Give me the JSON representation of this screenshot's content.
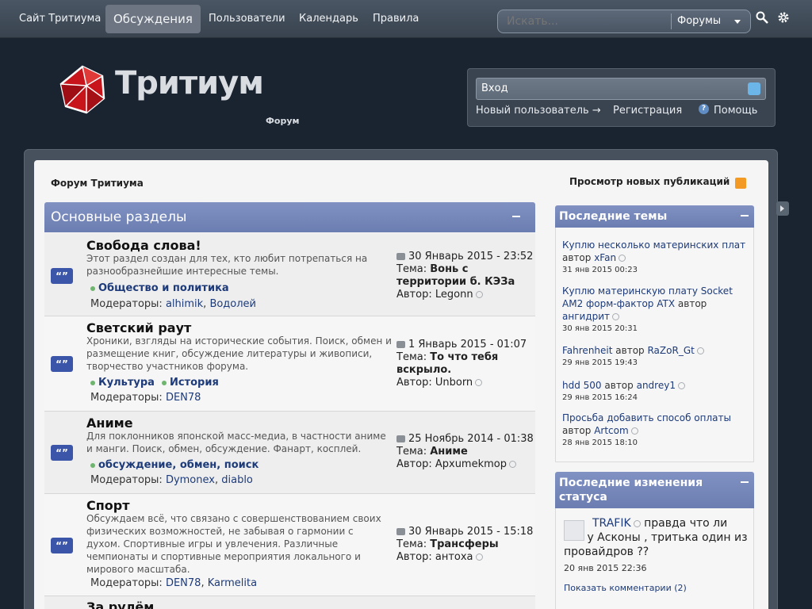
{
  "nav": {
    "items": [
      "Сайт Тритиума",
      "Обсуждения",
      "Пользователи",
      "Календарь",
      "Правила"
    ],
    "active": "Обсуждения",
    "search_placeholder": "Искать...",
    "search_scope": "Форумы"
  },
  "header": {
    "logo_text": "Тритиум",
    "logo_sub": "Форум",
    "login_label": "Вход",
    "new_user": "Новый пользователь →",
    "register": "Регистрация",
    "help": "Помощь"
  },
  "page": {
    "breadcrumb": "Форум Тритиума",
    "new_posts": "Просмотр новых публикаций",
    "category_title": "Основные разделы"
  },
  "forums": [
    {
      "name": "Свобода слова!",
      "desc": "Этот раздел создан для тех, кто любит потрепаться на разнообразнейшие интересные темы.",
      "subforums": [
        "Общество и политика"
      ],
      "moderators_label": "Модераторы:",
      "moderators": [
        "alhimik",
        "Водолей"
      ],
      "last_date": "30 Январь 2015 - 23:52",
      "topic_label": "Тема:",
      "last_topic": "Вонь с территории б. КЭЗа",
      "author_label": "Автор:",
      "last_author": "Legonn"
    },
    {
      "name": "Светский раут",
      "desc": "Хроники, взгляды на исторические события. Поиск, обмен и размещение книг, обсуждение литературы и живописи, творчество участников форума.",
      "subforums": [
        "Культура",
        "История"
      ],
      "moderators_label": "Модераторы:",
      "moderators": [
        "DEN78"
      ],
      "last_date": "1 Январь 2015 - 01:07",
      "topic_label": "Тема:",
      "last_topic": "То что тебя вскрыло.",
      "author_label": "Автор:",
      "last_author": "Unborn"
    },
    {
      "name": "Аниме",
      "desc": "Для поклонников японской масс-медиа, в частности аниме и манги. Поиск, обмен, обсуждение. Фанарт, косплей.",
      "subforums": [
        "обсуждение, обмен, поиск"
      ],
      "moderators_label": "Модераторы:",
      "moderators": [
        "Dymonex",
        "diablo"
      ],
      "last_date": "25 Ноябрь 2014 - 01:38",
      "topic_label": "Тема:",
      "last_topic": "Аниме",
      "author_label": "Автор:",
      "last_author": "Архumekmop"
    },
    {
      "name": "Спорт",
      "desc": "Обсуждаем всё, что связано с совершенствованием своих физических возможностей, не забывая о гармонии с духом. Спортивные игры и увлечения. Различные чемпионаты и спортивные мероприятия локального и мирового масштаба.",
      "subforums": [],
      "moderators_label": "Модераторы:",
      "moderators": [
        "DEN78",
        "Karmelita"
      ],
      "last_date": "30 Январь 2015 - 15:18",
      "topic_label": "Тема:",
      "last_topic": "Трансферы",
      "author_label": "Автор:",
      "last_author": "антоха"
    },
    {
      "name": "За рулём"
    }
  ],
  "sidebar": {
    "recent_title": "Последние темы",
    "author_word": "автор",
    "recent": [
      {
        "title": "Куплю несколько материнских плат",
        "author": "xFan",
        "date": "31 янв 2015 00:23"
      },
      {
        "title": "Куплю материнскую плату Socket AM2 форм-фактор ATX",
        "author": "ангидрит",
        "date": "30 янв 2015 20:31"
      },
      {
        "title": "Fahrenheit",
        "author": "RaZoR_Gt",
        "date": "29 янв 2015 19:43"
      },
      {
        "title": "hdd 500",
        "author": "andrey1",
        "date": "29 янв 2015 16:24"
      },
      {
        "title": "Просьба добавить способ оплаты",
        "author": "Artcom",
        "date": "28 янв 2015 18:10"
      }
    ],
    "status_title": "Последние изменения статуса",
    "status_user": "TRAFIK",
    "status_text": "правда что ли что у Асконы , тритька один из провайдров ??",
    "status_date": "20 янв 2015 22:36",
    "status_comments": "Показать комментарии (2)"
  },
  "colors": {
    "accent": "#7283b8",
    "nav_bg": "#424d5a",
    "link": "#1d3b7a"
  }
}
